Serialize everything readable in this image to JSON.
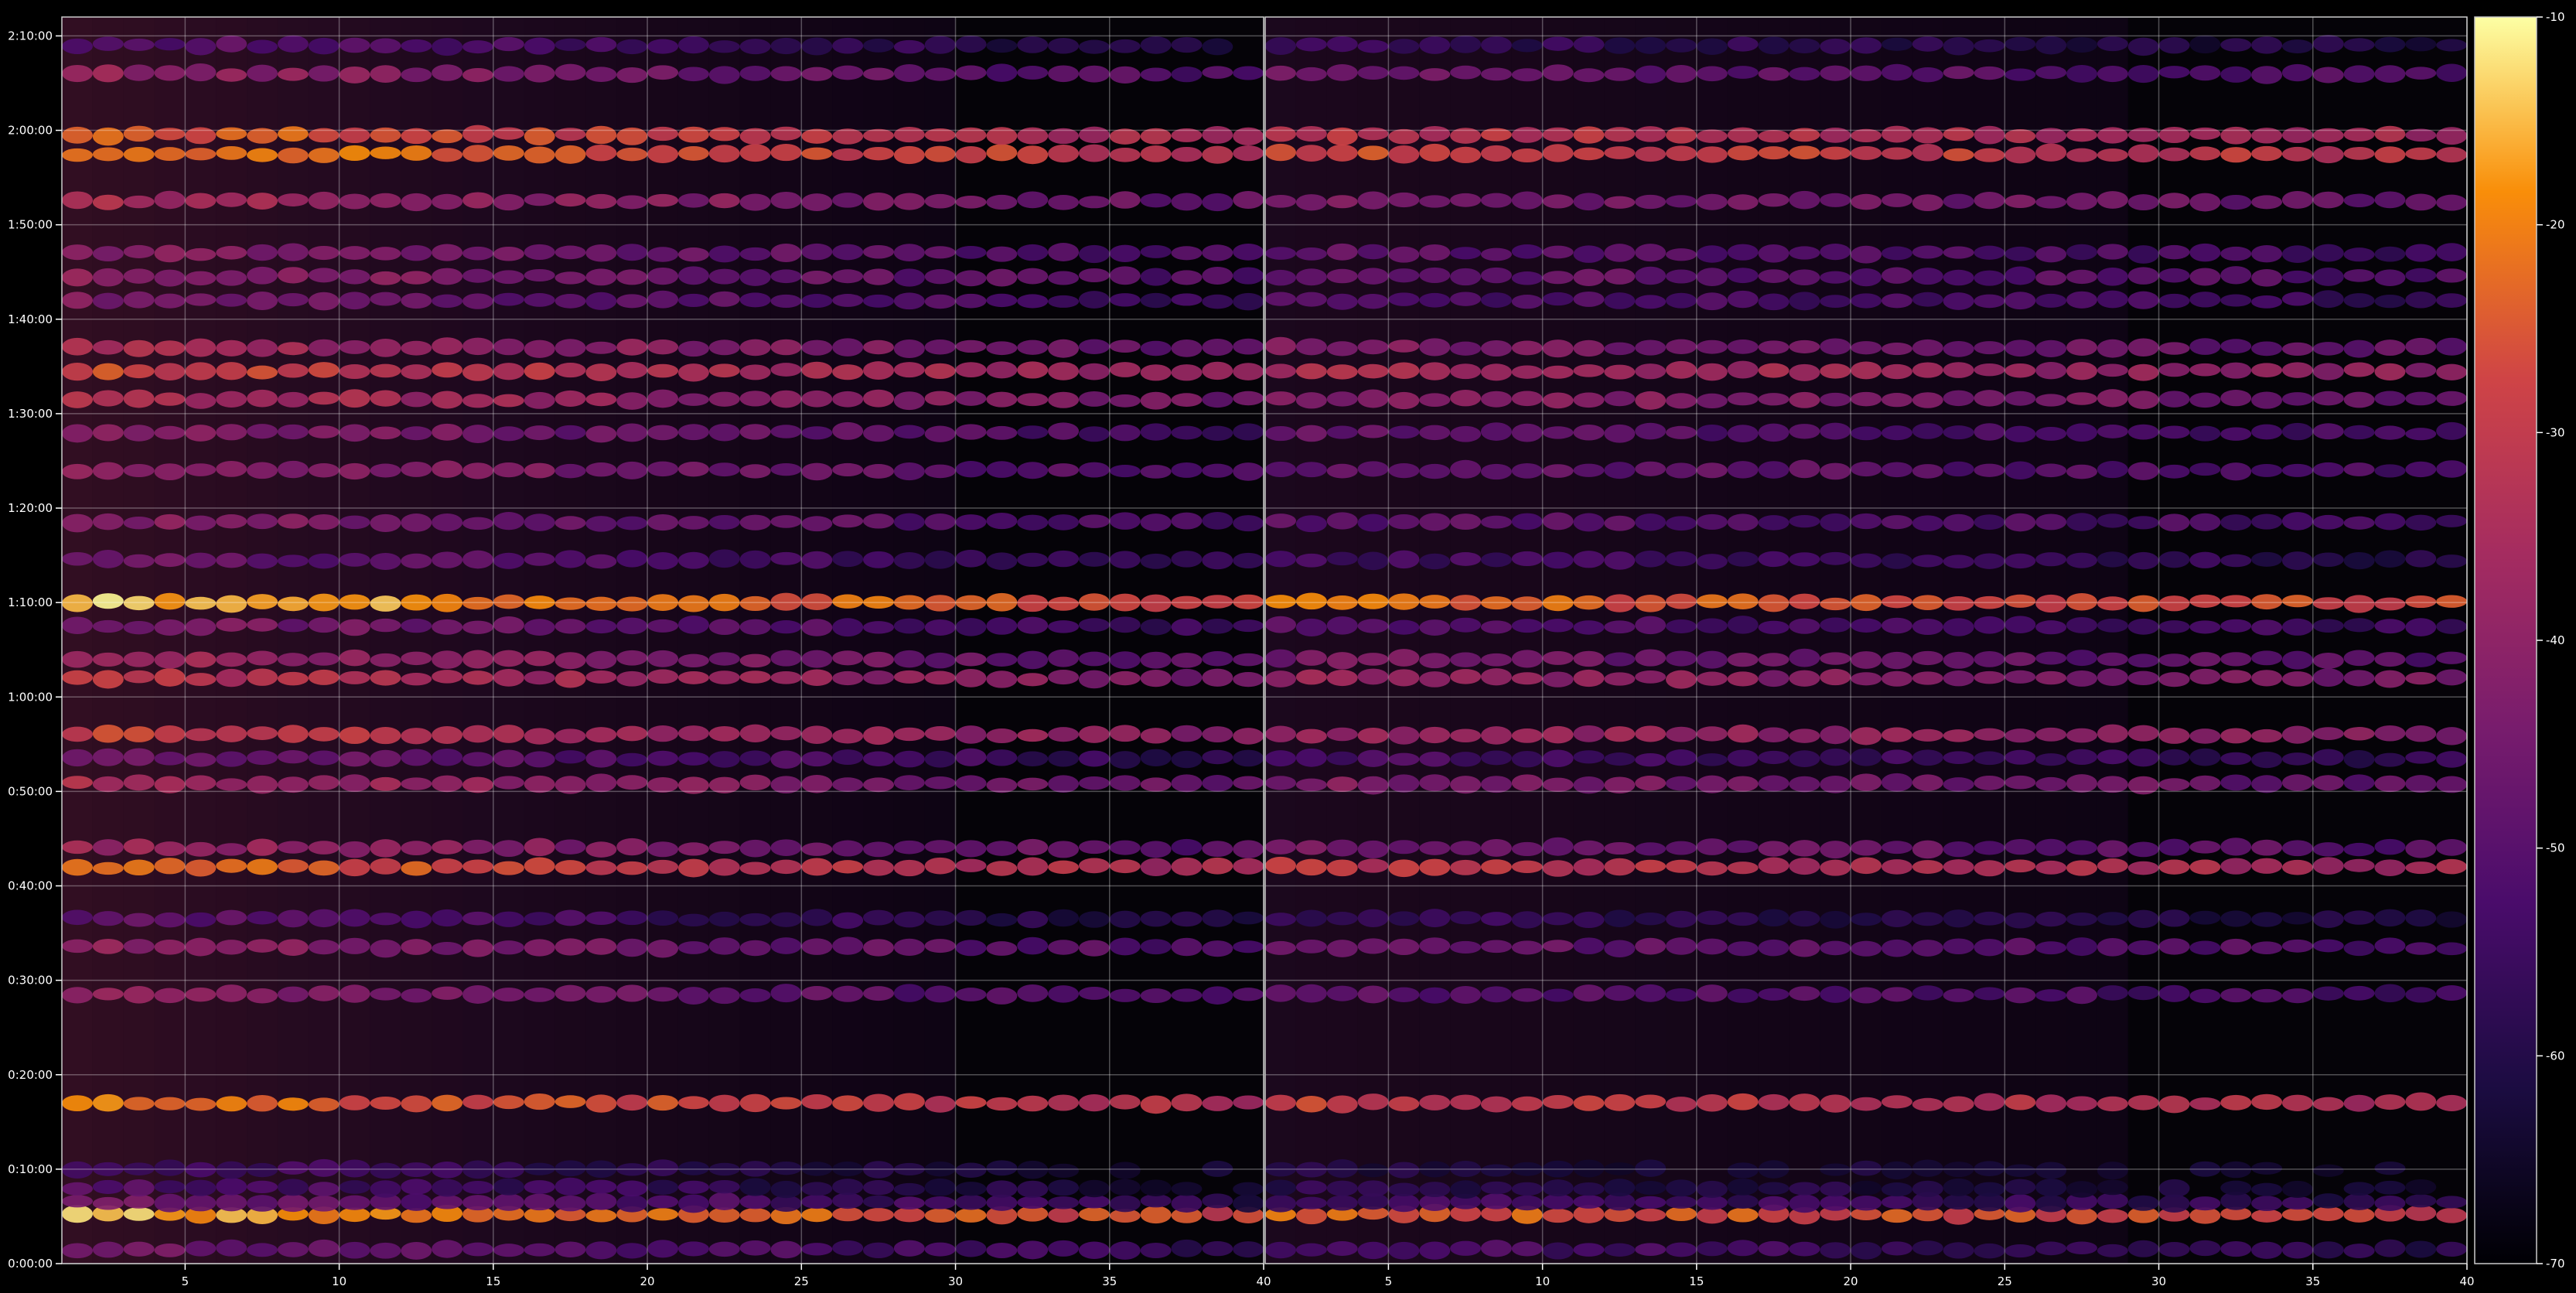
{
  "chart_data": {
    "type": "heatmap",
    "title": "",
    "xlabel": "",
    "ylabel": "",
    "panels": [
      {
        "name": "",
        "xlim": [
          1,
          40
        ],
        "xticks": [
          5,
          10,
          15,
          20,
          25,
          30,
          35,
          40
        ]
      },
      {
        "name": "",
        "xlim": [
          1,
          40
        ],
        "xticks": [
          5,
          10,
          15,
          20,
          25,
          30,
          35,
          40
        ]
      }
    ],
    "yaxis": {
      "ylim_minutes": [
        0,
        132
      ],
      "ticks": [
        {
          "minutes": 0,
          "label": "0:00:00"
        },
        {
          "minutes": 10,
          "label": "0:10:00"
        },
        {
          "minutes": 20,
          "label": "0:20:00"
        },
        {
          "minutes": 30,
          "label": "0:30:00"
        },
        {
          "minutes": 40,
          "label": "0:40:00"
        },
        {
          "minutes": 50,
          "label": "0:50:00"
        },
        {
          "minutes": 60,
          "label": "1:00:00"
        },
        {
          "minutes": 70,
          "label": "1:10:00"
        },
        {
          "minutes": 80,
          "label": "1:20:00"
        },
        {
          "minutes": 90,
          "label": "1:30:00"
        },
        {
          "minutes": 100,
          "label": "1:40:00"
        },
        {
          "minutes": 110,
          "label": "1:50:00"
        },
        {
          "minutes": 120,
          "label": "2:00:00"
        },
        {
          "minutes": 130,
          "label": "2:10:00"
        }
      ]
    },
    "colorbar": {
      "colormap": "inferno",
      "range": [
        -70,
        -10
      ],
      "ticks": [
        -10,
        -20,
        -30,
        -40,
        -50,
        -60,
        -70
      ]
    },
    "grid": true,
    "bands": [
      {
        "minutes": 1.5,
        "level": -44
      },
      {
        "minutes": 5.2,
        "level": -15
      },
      {
        "minutes": 6.5,
        "level": -45
      },
      {
        "minutes": 8.0,
        "level": -50
      },
      {
        "minutes": 10.0,
        "level": -52
      },
      {
        "minutes": 17.0,
        "level": -20
      },
      {
        "minutes": 28.5,
        "level": -40
      },
      {
        "minutes": 33.5,
        "level": -38
      },
      {
        "minutes": 36.5,
        "level": -48
      },
      {
        "minutes": 42.0,
        "level": -22
      },
      {
        "minutes": 44.0,
        "level": -36
      },
      {
        "minutes": 50.8,
        "level": -34
      },
      {
        "minutes": 53.5,
        "level": -44
      },
      {
        "minutes": 56.0,
        "level": -28
      },
      {
        "minutes": 62.0,
        "level": -30
      },
      {
        "minutes": 64.0,
        "level": -36
      },
      {
        "minutes": 67.5,
        "level": -42
      },
      {
        "minutes": 70.0,
        "level": -14
      },
      {
        "minutes": 74.5,
        "level": -45
      },
      {
        "minutes": 78.5,
        "level": -40
      },
      {
        "minutes": 84.0,
        "level": -38
      },
      {
        "minutes": 88.0,
        "level": -40
      },
      {
        "minutes": 91.5,
        "level": -32
      },
      {
        "minutes": 94.5,
        "level": -26
      },
      {
        "minutes": 97.0,
        "level": -34
      },
      {
        "minutes": 102.0,
        "level": -42
      },
      {
        "minutes": 104.5,
        "level": -38
      },
      {
        "minutes": 107.0,
        "level": -40
      },
      {
        "minutes": 112.5,
        "level": -34
      },
      {
        "minutes": 117.5,
        "level": -18
      },
      {
        "minutes": 119.5,
        "level": -22
      },
      {
        "minutes": 126.0,
        "level": -38
      },
      {
        "minutes": 129.0,
        "level": -48
      }
    ]
  }
}
